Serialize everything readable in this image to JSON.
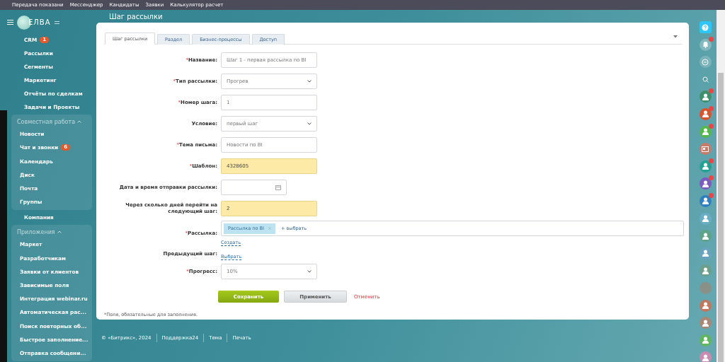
{
  "top_bar": {
    "items": [
      "Передача показани",
      "Мессенджер",
      "Кандидаты",
      "Заявки",
      "Калькулятор расчет"
    ]
  },
  "sidebar": {
    "logo": "ЕЛВА",
    "items": [
      {
        "kind": "link",
        "label": "CRM",
        "badge": "1"
      },
      {
        "kind": "link",
        "label": "Рассылки"
      },
      {
        "kind": "link",
        "label": "Сегменты"
      },
      {
        "kind": "link",
        "label": "Маркетинг"
      },
      {
        "kind": "link",
        "label": "Отчёты по сделкам"
      },
      {
        "kind": "link",
        "label": "Задачи и Проекты"
      },
      {
        "kind": "group",
        "label": "Совместная работа",
        "expanded": true,
        "children": [
          {
            "kind": "link",
            "label": "Новости"
          },
          {
            "kind": "link",
            "label": "Чат и звонки",
            "badge": "6"
          },
          {
            "kind": "link",
            "label": "Календарь"
          },
          {
            "kind": "link",
            "label": "Диск"
          },
          {
            "kind": "link",
            "label": "Почта"
          },
          {
            "kind": "link",
            "label": "Группы"
          }
        ]
      },
      {
        "kind": "link",
        "label": "Компания"
      },
      {
        "kind": "group",
        "label": "Приложения",
        "expanded": true,
        "children": [
          {
            "kind": "link",
            "label": "Маркет"
          },
          {
            "kind": "link",
            "label": "Разработчикам"
          },
          {
            "kind": "link",
            "label": "Заявки от клиентов"
          },
          {
            "kind": "link",
            "label": "Зависимые поля"
          },
          {
            "kind": "link",
            "label": "Интеграция webinar.ru"
          },
          {
            "kind": "link",
            "label": "Автоматическая рас..."
          },
          {
            "kind": "link",
            "label": "Поиск повторных об..."
          },
          {
            "kind": "link",
            "label": "Быстрое заполнение..."
          },
          {
            "kind": "link",
            "label": "Отправка сообщени..."
          }
        ]
      }
    ]
  },
  "page_title": "Шаг рассылки",
  "tabs": [
    {
      "label": "Шаг рассылки",
      "selected": true
    },
    {
      "label": "Раздел",
      "selected": false
    },
    {
      "label": "Бизнес-процессы",
      "selected": false
    },
    {
      "label": "Доступ",
      "selected": false
    }
  ],
  "form": {
    "required_mark": "*",
    "fields": [
      {
        "kind": "text",
        "label": "Название:",
        "required": true,
        "highlighted": false,
        "value": "Шаг 1 - первая рассылка по BI"
      },
      {
        "kind": "select",
        "label": "Тип рассылки:",
        "required": true,
        "highlighted": false,
        "value": "Прогрев"
      },
      {
        "kind": "text",
        "label": "Номер шага:",
        "required": true,
        "highlighted": false,
        "value": "1"
      },
      {
        "kind": "select",
        "label": "Условие:",
        "required": false,
        "highlighted": false,
        "value": "первый шаг"
      },
      {
        "kind": "text",
        "label": "Тема письма:",
        "required": true,
        "highlighted": false,
        "value": "Новости по BI"
      },
      {
        "kind": "text",
        "label": "Шаблон:",
        "required": true,
        "highlighted": true,
        "value": "4328605"
      },
      {
        "kind": "date",
        "label": "Дата и время отправки рассылки:",
        "required": false,
        "highlighted": false
      },
      {
        "kind": "text",
        "label": "Через сколько дней перейти на следующий шаг:",
        "required": false,
        "highlighted": true,
        "value": "2"
      },
      {
        "kind": "tags",
        "label": "Рассылка:",
        "required": true,
        "tags": [
          "Рассылка по BI"
        ],
        "add_label": "+ выбрать",
        "link": "Создать"
      },
      {
        "kind": "link",
        "label": "Предыдущий шаг:",
        "required": false,
        "link": "Выбрать"
      },
      {
        "kind": "select",
        "label": "Прогресс:",
        "required": true,
        "highlighted": false,
        "value": "10%"
      }
    ],
    "buttons": [
      {
        "kind": "primary",
        "label": "Сохранить"
      },
      {
        "kind": "secondary",
        "label": "Применить"
      },
      {
        "kind": "cancel",
        "label": "Отменить"
      }
    ],
    "note": "*Поля, обязательные для заполнения."
  },
  "footer": [
    "© «Битрикс», 2024",
    "Поддержка24",
    "Тема",
    "Печать"
  ],
  "right_rail": [
    {
      "kind": "help"
    },
    {
      "kind": "bell",
      "badge": true
    },
    {
      "kind": "chat",
      "badge": false
    },
    {
      "kind": "search",
      "badge": false
    },
    {
      "kind": "avatar",
      "color": "#3f8f6a",
      "badge": true
    },
    {
      "kind": "avatar",
      "color": "#d9532c",
      "badge": true
    },
    {
      "kind": "avatar",
      "color": "#55b84a",
      "badge": true
    },
    {
      "kind": "card",
      "color": "#c67a6a",
      "badge": false
    },
    {
      "kind": "avatar",
      "color": "#23a193",
      "badge": true
    },
    {
      "kind": "avatar",
      "color": "#7b5bbf",
      "badge": true
    },
    {
      "kind": "avatar",
      "color": "#2f7fc1",
      "badge": true
    },
    {
      "kind": "avatar",
      "color": "#6aaec6",
      "badge": false
    },
    {
      "kind": "avatar",
      "color": "#5ea388",
      "badge": false
    },
    {
      "kind": "avatar",
      "color": "#6aa3c0",
      "badge": false
    },
    {
      "kind": "avatar",
      "color": "#6e9e8c",
      "badge": false
    },
    {
      "kind": "photo",
      "badge": false
    },
    {
      "kind": "avatar",
      "color": "#c2775e",
      "badge": false
    },
    {
      "kind": "avatar",
      "color": "#a88777",
      "badge": false
    },
    {
      "kind": "avatar",
      "color": "#62b55f",
      "badge": false
    },
    {
      "kind": "avatar",
      "color": "#c98bb2",
      "badge": false
    }
  ]
}
